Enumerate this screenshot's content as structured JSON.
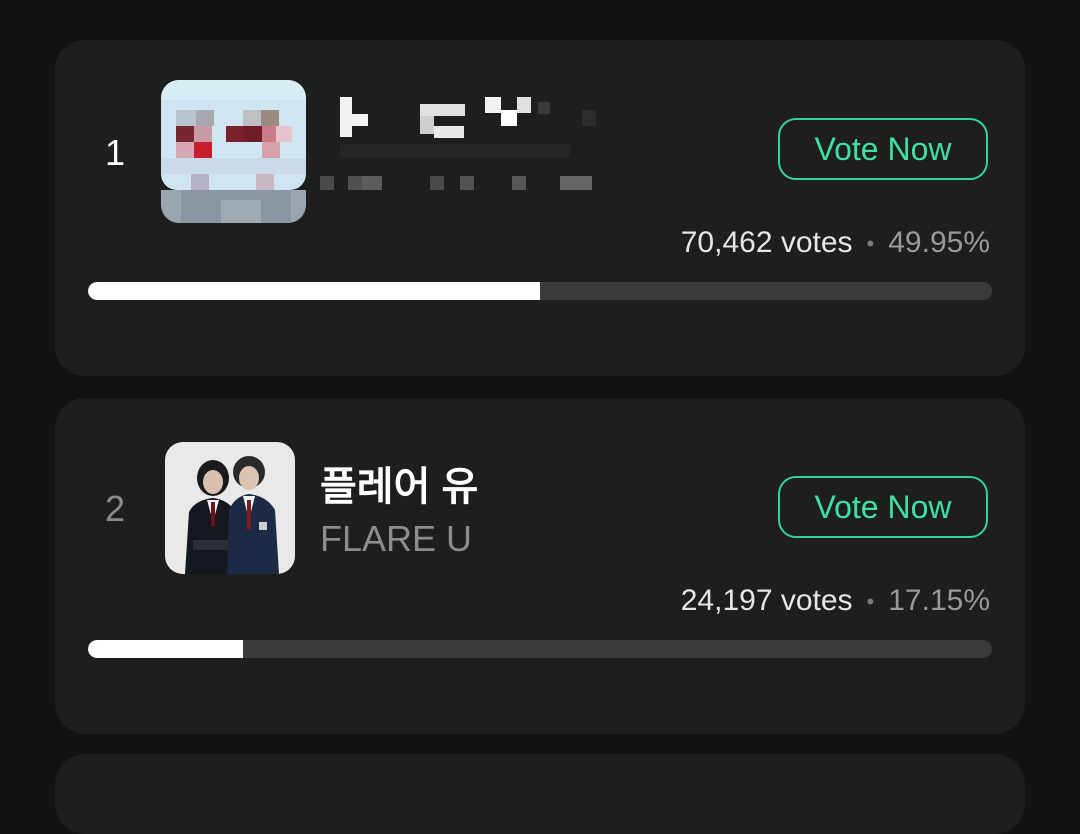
{
  "items": [
    {
      "rank": "1",
      "name_ko": "",
      "name_en": "",
      "vote_button": "Vote Now",
      "votes": "70,462 votes",
      "separator": "•",
      "percent": "49.95%",
      "progress": 0.4995,
      "thumbnail": "pixelated-artist-photo",
      "name_pixelated": true
    },
    {
      "rank": "2",
      "name_ko": "플레어 유",
      "name_en": "FLARE U",
      "vote_button": "Vote Now",
      "votes": "24,197 votes",
      "separator": "•",
      "percent": "17.15%",
      "progress": 0.1715,
      "thumbnail": "artist-duo-photo"
    }
  ],
  "colors": {
    "background": "#121212",
    "card": "#1e1e1e",
    "accent": "#3ee0a3",
    "track": "#3a3a3a",
    "fill": "#ffffff"
  }
}
